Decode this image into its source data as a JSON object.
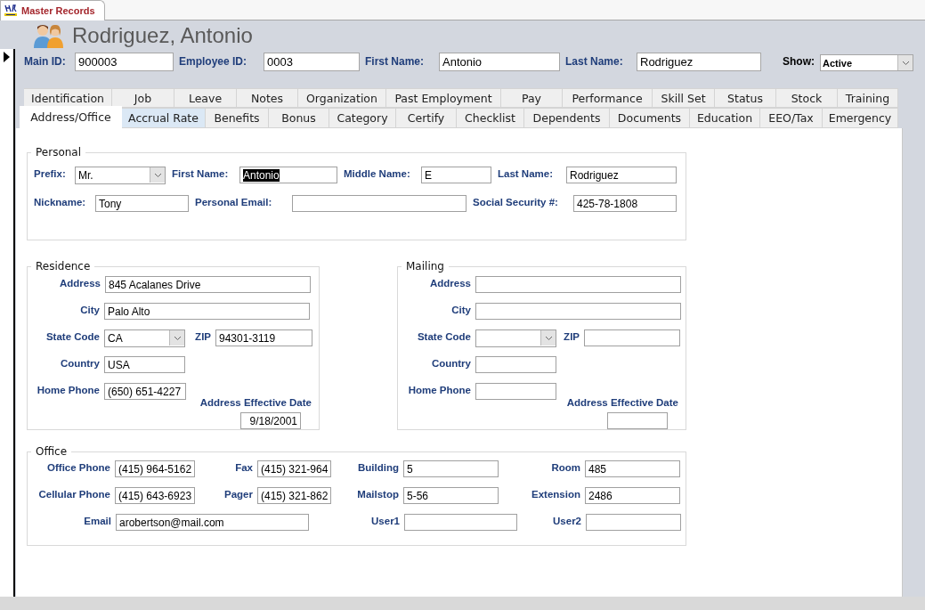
{
  "document_tab": {
    "title": "Master Records"
  },
  "header": {
    "title": "Rodriguez, Antonio",
    "fields": [
      {
        "label": "Main ID:",
        "value": "900003"
      },
      {
        "label": "Employee ID:",
        "value": "0003"
      },
      {
        "label": "First Name:",
        "value": "Antonio"
      },
      {
        "label": "Last Name:",
        "value": "Rodriguez"
      }
    ],
    "show": {
      "label": "Show:",
      "value": "Active"
    }
  },
  "tabs": {
    "rows": [
      [
        {
          "label": "Identification",
          "selected": false,
          "highlighted": false
        },
        {
          "label": "Job",
          "selected": false,
          "highlighted": false
        },
        {
          "label": "Leave",
          "selected": false,
          "highlighted": false
        },
        {
          "label": "Notes",
          "selected": false,
          "highlighted": false
        },
        {
          "label": "Organization",
          "selected": false,
          "highlighted": false
        },
        {
          "label": "Past Employment",
          "selected": false,
          "highlighted": false
        },
        {
          "label": "Pay",
          "selected": false,
          "highlighted": false
        },
        {
          "label": "Performance",
          "selected": false,
          "highlighted": false
        },
        {
          "label": "Skill Set",
          "selected": false,
          "highlighted": false
        },
        {
          "label": "Status",
          "selected": false,
          "highlighted": false
        },
        {
          "label": "Stock",
          "selected": false,
          "highlighted": false
        },
        {
          "label": "Training",
          "selected": false,
          "highlighted": false
        }
      ],
      [
        {
          "label": "Address/Office",
          "selected": true,
          "highlighted": false
        },
        {
          "label": "Accrual Rate",
          "selected": false,
          "highlighted": true
        },
        {
          "label": "Benefits",
          "selected": false,
          "highlighted": false
        },
        {
          "label": "Bonus",
          "selected": false,
          "highlighted": false
        },
        {
          "label": "Category",
          "selected": false,
          "highlighted": false
        },
        {
          "label": "Certify",
          "selected": false,
          "highlighted": false
        },
        {
          "label": "Checklist",
          "selected": false,
          "highlighted": false
        },
        {
          "label": "Dependents",
          "selected": false,
          "highlighted": false
        },
        {
          "label": "Documents",
          "selected": false,
          "highlighted": false
        },
        {
          "label": "Education",
          "selected": false,
          "highlighted": false
        },
        {
          "label": "EEO/Tax",
          "selected": false,
          "highlighted": false
        },
        {
          "label": "Emergency",
          "selected": false,
          "highlighted": false
        }
      ]
    ]
  },
  "personal": {
    "title": "Personal",
    "fields": [
      {
        "label": "Prefix:",
        "value": "Mr.",
        "kind": "combo"
      },
      {
        "label": "First Name:",
        "value": "Antonio",
        "kind": "text",
        "text_selected": true
      },
      {
        "label": "Middle Name:",
        "value": "E",
        "kind": "text"
      },
      {
        "label": "Last Name:",
        "value": "Rodriguez",
        "kind": "text"
      },
      {
        "label": "Nickname:",
        "value": "Tony",
        "kind": "text"
      },
      {
        "label": "Personal Email:",
        "kind": "text"
      },
      {
        "label": "Social Security #:",
        "value": "425-78-1808",
        "kind": "text"
      }
    ]
  },
  "residence": {
    "title": "Residence",
    "fields": [
      {
        "label": "Address",
        "value": "845 Acalanes Drive",
        "kind": "text"
      },
      {
        "label": "City",
        "value": "Palo Alto",
        "kind": "text"
      },
      {
        "label": "State Code",
        "value": "CA",
        "kind": "combo"
      },
      {
        "label": "ZIP",
        "value": "94301-3119",
        "kind": "text"
      },
      {
        "label": "Country",
        "value": "USA",
        "kind": "text"
      },
      {
        "label": "Home Phone",
        "value": "(650) 651-4227",
        "kind": "text"
      }
    ],
    "effective_date": {
      "label": "Address Effective Date",
      "value": "9/18/2001"
    }
  },
  "mailing": {
    "title": "Mailing",
    "fields": [
      {
        "label": "Address",
        "kind": "text"
      },
      {
        "label": "City",
        "kind": "text"
      },
      {
        "label": "State Code",
        "kind": "combo"
      },
      {
        "label": "ZIP",
        "kind": "text"
      },
      {
        "label": "Country",
        "kind": "text"
      },
      {
        "label": "Home Phone",
        "kind": "text"
      }
    ],
    "effective_date": {
      "label": "Address Effective Date"
    }
  },
  "office": {
    "title": "Office",
    "fields": [
      {
        "label": "Office Phone",
        "value": "(415) 964-5162",
        "kind": "text"
      },
      {
        "label": "Fax",
        "value": "(415) 321-964",
        "kind": "text"
      },
      {
        "label": "Building",
        "value": "5",
        "kind": "text"
      },
      {
        "label": "Room",
        "value": "485",
        "kind": "text"
      },
      {
        "label": "Cellular Phone",
        "value": "(415) 643-6923",
        "kind": "text"
      },
      {
        "label": "Pager",
        "value": "(415) 321-862",
        "kind": "text"
      },
      {
        "label": "Mailstop",
        "value": "5-56",
        "kind": "text"
      },
      {
        "label": "Extension",
        "value": "2486",
        "kind": "text"
      },
      {
        "label": "Email",
        "value": "arobertson@mail.com",
        "kind": "text"
      },
      {
        "label": "User1",
        "kind": "text"
      },
      {
        "label": "User2",
        "kind": "text"
      }
    ]
  }
}
